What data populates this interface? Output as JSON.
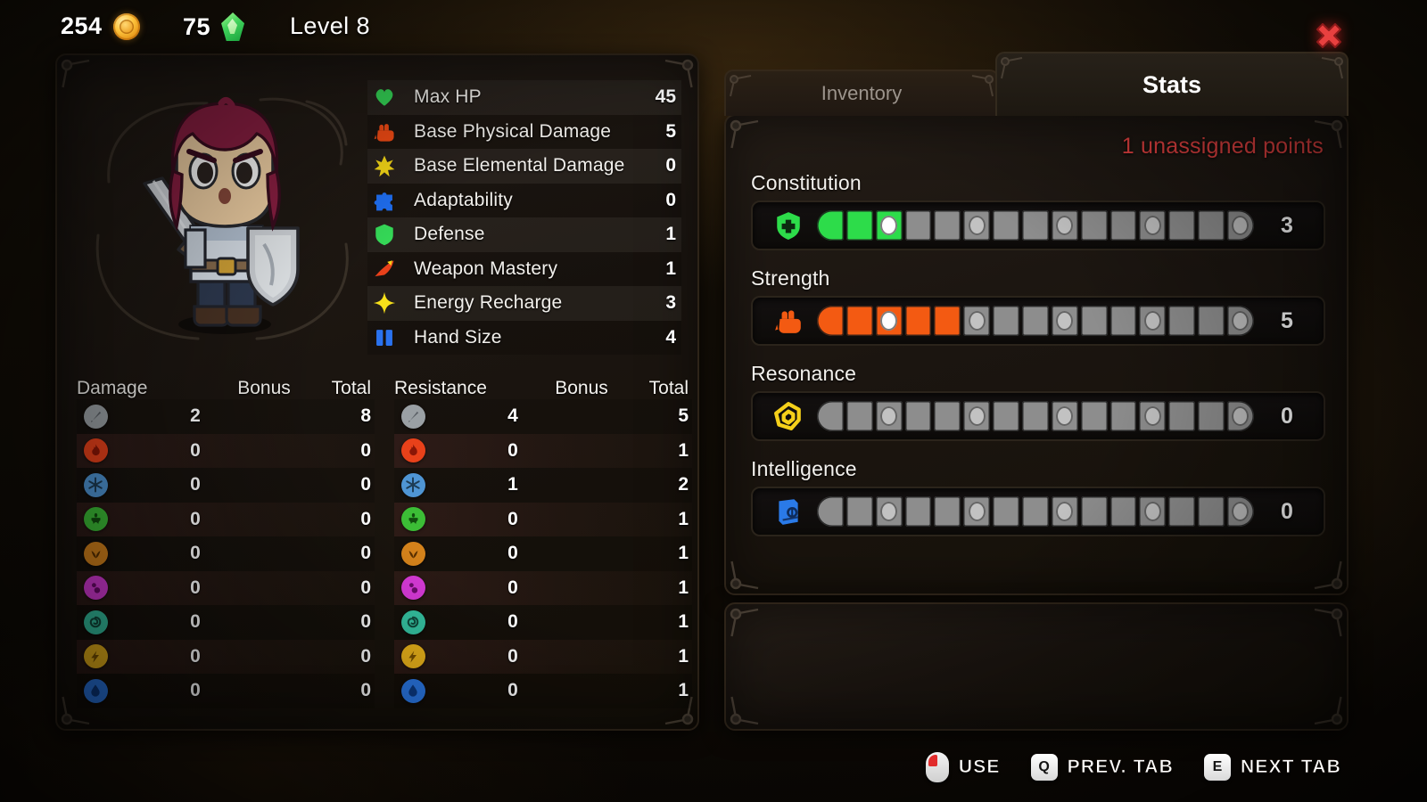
{
  "hud": {
    "gold": "254",
    "gems": "75",
    "level": "Level 8",
    "gold_icon": "coin-icon",
    "gem_icon": "gem-icon",
    "close_icon": "close-icon"
  },
  "character": {
    "portrait_name": "warrior-chibi-portrait",
    "hair_color": "#8c1f43",
    "skin_color": "#f6d5a8"
  },
  "stats": {
    "rows": [
      {
        "icon": "heart-icon",
        "color": "#35d857",
        "label": "Max HP",
        "value": "45"
      },
      {
        "icon": "fist-icon",
        "color": "#f04a14",
        "label": "Base Physical Damage",
        "value": "5"
      },
      {
        "icon": "star-burst-icon",
        "color": "#f5d716",
        "label": "Base Elemental Damage",
        "value": "0"
      },
      {
        "icon": "puzzle-icon",
        "color": "#1f6ef0",
        "label": "Adaptability",
        "value": "0"
      },
      {
        "icon": "shield-icon",
        "color": "#35d857",
        "label": "Defense",
        "value": "1"
      },
      {
        "icon": "blade-slash-icon",
        "color": "#e8401a",
        "label": "Weapon Mastery",
        "value": "1"
      },
      {
        "icon": "sparkle-icon",
        "color": "#f7e01a",
        "label": "Energy Recharge",
        "value": "3"
      },
      {
        "icon": "cards-icon",
        "color": "#2a72ef",
        "label": "Hand Size",
        "value": "4"
      }
    ]
  },
  "damage_table": {
    "headers": {
      "name": "Damage",
      "bonus": "Bonus",
      "total": "Total"
    },
    "rows": [
      {
        "element": "physical-sword-icon",
        "color": "#9aa0a4",
        "bonus": "2",
        "total": "8"
      },
      {
        "element": "fire-icon",
        "color": "#e8411a",
        "bonus": "0",
        "total": "0"
      },
      {
        "element": "ice-icon",
        "color": "#4f95d4",
        "bonus": "0",
        "total": "0"
      },
      {
        "element": "poison-icon",
        "color": "#3cbd36",
        "bonus": "0",
        "total": "0"
      },
      {
        "element": "bleed-icon",
        "color": "#d4821b",
        "bonus": "0",
        "total": "0"
      },
      {
        "element": "corruption-icon",
        "color": "#d83ad8",
        "bonus": "0",
        "total": "0"
      },
      {
        "element": "wind-icon",
        "color": "#35c3a2",
        "bonus": "0",
        "total": "0"
      },
      {
        "element": "lightning-icon",
        "color": "#ecb41a",
        "bonus": "0",
        "total": "0"
      },
      {
        "element": "water-icon",
        "color": "#2a78e6",
        "bonus": "0",
        "total": "0"
      }
    ]
  },
  "resistance_table": {
    "headers": {
      "name": "Resistance",
      "bonus": "Bonus",
      "total": "Total"
    },
    "rows": [
      {
        "element": "physical-sword-icon",
        "color": "#9aa0a4",
        "bonus": "4",
        "total": "5"
      },
      {
        "element": "fire-icon",
        "color": "#e8411a",
        "bonus": "0",
        "total": "1"
      },
      {
        "element": "ice-icon",
        "color": "#4f95d4",
        "bonus": "1",
        "total": "2"
      },
      {
        "element": "poison-icon",
        "color": "#3cbd36",
        "bonus": "0",
        "total": "1"
      },
      {
        "element": "bleed-icon",
        "color": "#d4821b",
        "bonus": "0",
        "total": "1"
      },
      {
        "element": "corruption-icon",
        "color": "#d83ad8",
        "bonus": "0",
        "total": "1"
      },
      {
        "element": "wind-icon",
        "color": "#35c3a2",
        "bonus": "0",
        "total": "1"
      },
      {
        "element": "lightning-icon",
        "color": "#ecb41a",
        "bonus": "0",
        "total": "1"
      },
      {
        "element": "water-icon",
        "color": "#2a78e6",
        "bonus": "0",
        "total": "1"
      }
    ]
  },
  "tabs": [
    {
      "label": "Inventory",
      "active": false,
      "name": "tab-inventory"
    },
    {
      "label": "Stats",
      "active": true,
      "name": "tab-stats"
    }
  ],
  "attributes_panel": {
    "unassigned_text": "1 unassigned points",
    "unassigned_color": "#e0403f",
    "segments_total": 15,
    "milestones": [
      3,
      6,
      9,
      12,
      15
    ],
    "attributes": [
      {
        "name": "Constitution",
        "icon": "shield-cross-icon",
        "icon_color": "#2ddc4a",
        "filled": 3,
        "value": "3",
        "fill_color": "#2ddc4a"
      },
      {
        "name": "Strength",
        "icon": "fist-icon",
        "icon_color": "#f35a12",
        "filled": 5,
        "value": "5",
        "fill_color": "#f35a12"
      },
      {
        "name": "Resonance",
        "icon": "spiral-icon",
        "icon_color": "#f5d01a",
        "filled": 0,
        "value": "0",
        "fill_color": "#f5d01a"
      },
      {
        "name": "Intelligence",
        "icon": "book-icon",
        "icon_color": "#2a7ae8",
        "filled": 0,
        "value": "0",
        "fill_color": "#2a7ae8"
      }
    ]
  },
  "footer_actions": [
    {
      "key_icon": "mouse-left-click-icon",
      "key": "",
      "label": "USE",
      "name": "action-use"
    },
    {
      "key_icon": "key-icon",
      "key": "Q",
      "label": "PREV. TAB",
      "name": "action-prev-tab"
    },
    {
      "key_icon": "key-icon",
      "key": "E",
      "label": "NEXT TAB",
      "name": "action-next-tab"
    }
  ]
}
